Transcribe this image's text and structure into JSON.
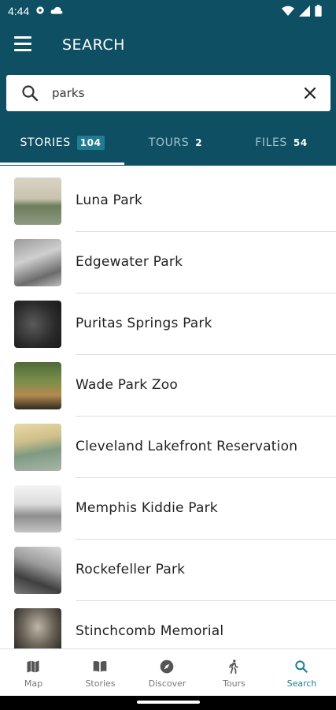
{
  "status_bar": {
    "time": "4:44"
  },
  "app_bar": {
    "title": "SEARCH"
  },
  "search": {
    "value": "parks"
  },
  "tabs": [
    {
      "label": "STORIES",
      "count": "104"
    },
    {
      "label": "TOURS",
      "count": "2"
    },
    {
      "label": "FILES",
      "count": "54"
    }
  ],
  "results": [
    {
      "title": "Luna Park"
    },
    {
      "title": "Edgewater Park"
    },
    {
      "title": "Puritas Springs Park"
    },
    {
      "title": "Wade Park Zoo"
    },
    {
      "title": "Cleveland Lakefront Reservation"
    },
    {
      "title": "Memphis Kiddie Park"
    },
    {
      "title": "Rockefeller Park"
    },
    {
      "title": "Stinchcomb Memorial"
    }
  ],
  "bottom_nav": [
    {
      "label": "Map",
      "icon": "map-icon"
    },
    {
      "label": "Stories",
      "icon": "book-icon"
    },
    {
      "label": "Discover",
      "icon": "compass-icon"
    },
    {
      "label": "Tours",
      "icon": "walk-icon"
    },
    {
      "label": "Search",
      "icon": "search-icon"
    }
  ],
  "colors": {
    "primary": "#0f4f63",
    "accent": "#1f7c93"
  }
}
